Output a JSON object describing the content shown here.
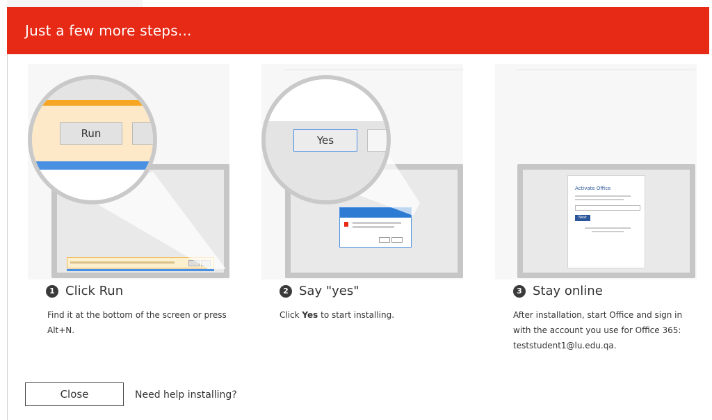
{
  "header": {
    "title": "Just a few more steps..."
  },
  "steps": [
    {
      "number": "1",
      "title": "Click Run",
      "description": "Find it at the bottom of the screen or press Alt+N.",
      "zoom_button_label": "Run"
    },
    {
      "number": "2",
      "title": "Say \"yes\"",
      "description_prefix": "Click ",
      "description_bold": "Yes",
      "description_suffix": " to start installing.",
      "zoom_button_label": "Yes"
    },
    {
      "number": "3",
      "title": "Stay online",
      "description": "After installation, start Office and sign in with the account you use for Office 365: teststudent1@lu.edu.qa.",
      "mini_dialog_title": "Activate Office",
      "mini_dialog_button": "Next"
    }
  ],
  "footer": {
    "close_label": "Close",
    "help_link": "Need help installing?"
  },
  "colors": {
    "brand_red": "#e62a16",
    "run_highlight": "#f6a623",
    "blue_bar": "#4a90e2",
    "office_blue": "#2b579a"
  }
}
